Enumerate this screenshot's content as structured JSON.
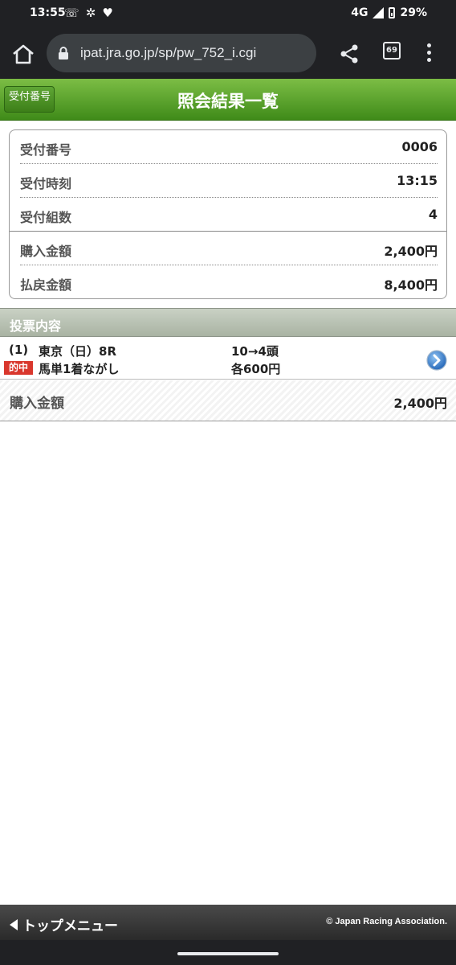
{
  "status": {
    "time": "13:55",
    "network": "4G",
    "battery": "29%"
  },
  "browser": {
    "url": "ipat.jra.go.jp/sp/pw_752_i.cgi",
    "tab_count": "69"
  },
  "header": {
    "back_label": "受付番号",
    "title": "照会結果一覧"
  },
  "info": {
    "rows": [
      {
        "label": "受付番号",
        "value": "0006"
      },
      {
        "label": "受付時刻",
        "value": "13:15"
      },
      {
        "label": "受付組数",
        "value": "4"
      },
      {
        "label": "購入金額",
        "value": "2,400円"
      },
      {
        "label": "払戻金額",
        "value": "8,400円"
      }
    ]
  },
  "section": {
    "title": "投票内容"
  },
  "bet": {
    "number": "(1)",
    "race": "東京（日）8R",
    "hit_badge": "的中",
    "type": "馬単1着ながし",
    "combination": "10→4頭",
    "amount_each": "各600円"
  },
  "total": {
    "label": "購入金額",
    "value": "2,400円"
  },
  "footer": {
    "menu_label": "トップメニュー",
    "copyright": "© Japan Racing Association."
  },
  "colors": {
    "header_green": "#4f9a25",
    "hit_red": "#d9372d",
    "footer_dark": "#333333"
  }
}
